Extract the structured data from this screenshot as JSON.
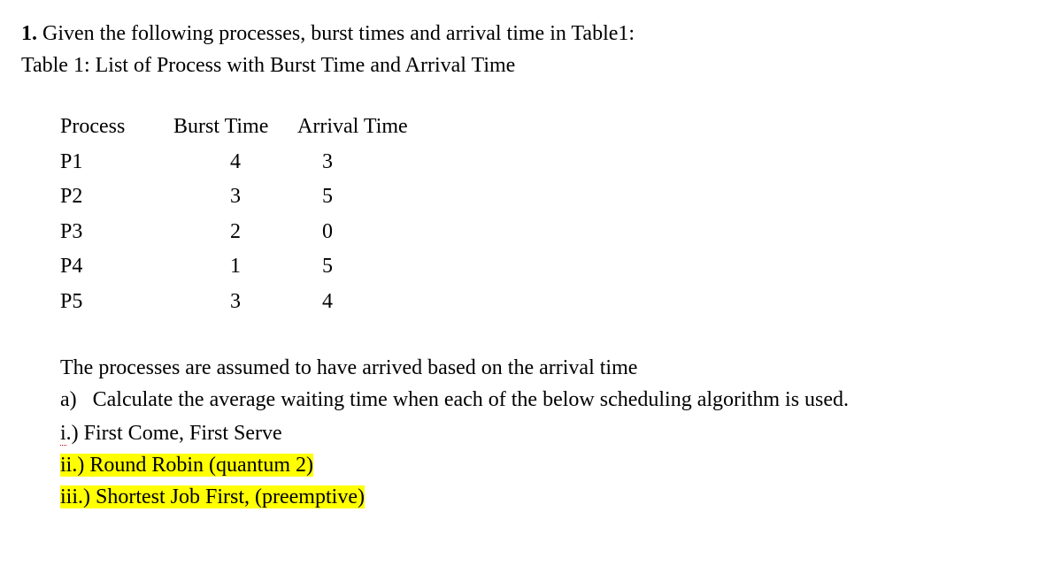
{
  "intro": {
    "number": "1.",
    "line1_rest": " Given the following processes, burst times and arrival time in Table1:",
    "line2": "Table 1: List of Process with Burst Time and Arrival Time"
  },
  "table": {
    "headers": {
      "process": "Process",
      "burst": "Burst Time",
      "arrival": "Arrival Time"
    },
    "rows": [
      {
        "process": "P1",
        "burst": "4",
        "arrival": "3"
      },
      {
        "process": "P2",
        "burst": "3",
        "arrival": "5"
      },
      {
        "process": "P3",
        "burst": "2",
        "arrival": "0"
      },
      {
        "process": "P4",
        "burst": "1",
        "arrival": "5"
      },
      {
        "process": "P5",
        "burst": "3",
        "arrival": "4"
      }
    ]
  },
  "body": {
    "assumption": "The processes are assumed to have arrived based on the arrival time",
    "part_a": "a)   Calculate the average waiting time when each of the below scheduling algorithm is used.",
    "items": {
      "i_num": "i",
      "i_rest": ".) First Come, First Serve",
      "ii": "ii.) Round Robin (quantum 2)",
      "iii": "iii.) Shortest Job First, (preemptive)"
    }
  },
  "chart_data": {
    "type": "table",
    "title": "Table 1: List of Process with Burst Time and Arrival Time",
    "columns": [
      "Process",
      "Burst Time",
      "Arrival Time"
    ],
    "rows": [
      [
        "P1",
        4,
        3
      ],
      [
        "P2",
        3,
        5
      ],
      [
        "P3",
        2,
        0
      ],
      [
        "P4",
        1,
        5
      ],
      [
        "P5",
        3,
        4
      ]
    ]
  }
}
